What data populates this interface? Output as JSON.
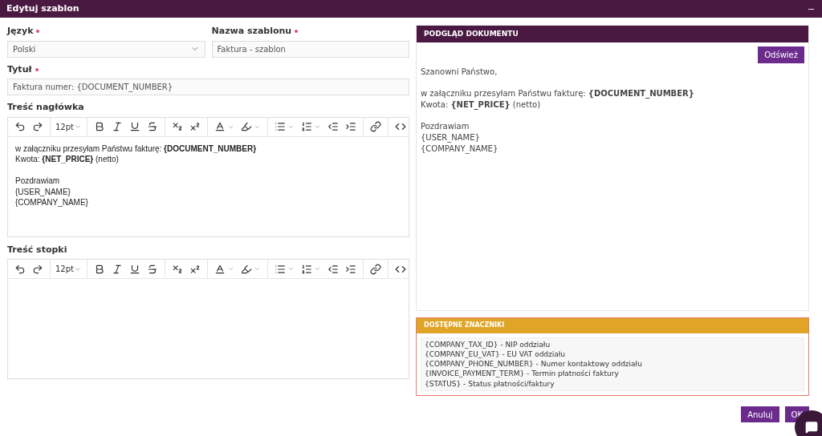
{
  "window": {
    "title": "Edytuj szablon"
  },
  "fields": {
    "language": {
      "label": "Język",
      "required": true,
      "value": "Polski"
    },
    "name": {
      "label": "Nazwa szablonu",
      "required": true,
      "value": "Faktura - szablon"
    },
    "title": {
      "label": "Tytuł",
      "required": true,
      "value": "Faktura numer: {DOCUMENT_NUMBER}"
    }
  },
  "editors": [
    {
      "label": "Treść nagłówka",
      "font_size": "12pt",
      "paragraphs": [
        [
          "w załączniku przesyłam Państwu fakturę: **{DOCUMENT_NUMBER}**",
          "Kwota: **{NET_PRICE}** (netto)"
        ],
        [
          "Pozdrawiam",
          "{USER_NAME}",
          "{COMPANY_NAME}"
        ]
      ]
    },
    {
      "label": "Treść stopki",
      "font_size": "12pt"
    }
  ],
  "preview": {
    "title": "PODGLĄD DOKUMENTU",
    "refresh_button": "Odśwież",
    "paragraphs": [
      [
        "Szanowni Państwo,"
      ],
      [
        "w załączniku przesyłam Państwu fakturę: **{DOCUMENT_NUMBER}**",
        "Kwota: **{NET_PRICE}** (netto)"
      ],
      [
        "Pozdrawiam",
        "{USER_NAME}",
        "{COMPANY_NAME}"
      ]
    ]
  },
  "tags": {
    "title": "DOSTĘPNE ZNACZNIKI",
    "items": [
      "{COMPANY_TAX_ID} - NIP oddziału",
      "{COMPANY_EU_VAT} - EU VAT oddziału",
      "{COMPANY_PHONE_NUMBER} - Numer kontaktowy oddziału",
      "{INVOICE_PAYMENT_TERM} - Termin płatności faktury",
      "{STATUS} - Status płatności/faktury"
    ]
  },
  "buttons": [
    "Anuluj",
    "OK"
  ]
}
